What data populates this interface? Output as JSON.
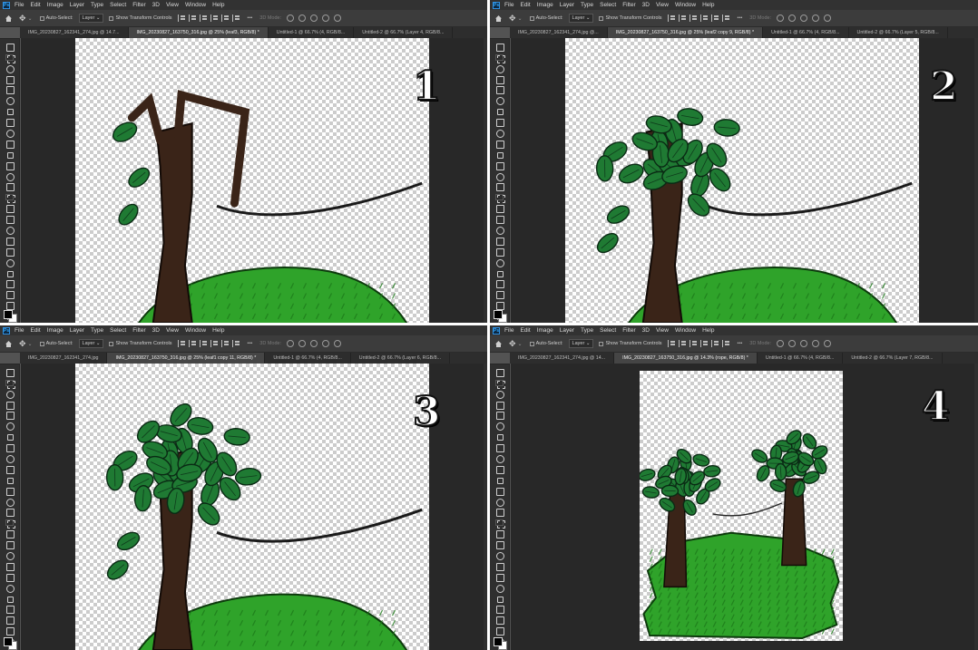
{
  "menu": {
    "ps_logo": "Ps",
    "items": [
      "File",
      "Edit",
      "Image",
      "Layer",
      "Type",
      "Select",
      "Filter",
      "3D",
      "View",
      "Window",
      "Help"
    ]
  },
  "options_bar": {
    "home_icon": "home-icon",
    "move_icon": "move-tool-icon",
    "caret": "⌄",
    "auto_select": "Auto-Select:",
    "layer": "Layer",
    "transform": "Show Transform Controls",
    "more": "•••",
    "mode3d": "3D Mode:"
  },
  "panels": [
    {
      "step": "1",
      "tabs": [
        {
          "label": "IMG_20230827_162341_274.jpg @ 14.7...",
          "active": false
        },
        {
          "label": "IMG_20230827_163750_316.jpg @ 25% (leaf3, RGB/8) *",
          "active": true
        },
        {
          "label": "Untitled-1 @ 66.7% (4, RGB/8...",
          "active": false
        },
        {
          "label": "Untitled-2 @ 66.7% (Layer 4, RGB/8...",
          "active": false
        }
      ]
    },
    {
      "step": "2",
      "tabs": [
        {
          "label": "IMG_20230827_162341_274.jpg @...",
          "active": false
        },
        {
          "label": "IMG_20230827_163750_316.jpg @ 25% (leaf2 copy 9, RGB/8) *",
          "active": true
        },
        {
          "label": "Untitled-1 @ 66.7% (4, RGB/8...",
          "active": false
        },
        {
          "label": "Untitled-2 @ 66.7% (Layer 5, RGB/8...",
          "active": false
        }
      ]
    },
    {
      "step": "3",
      "tabs": [
        {
          "label": "IMG_20230827_162341_274.jpg",
          "active": false
        },
        {
          "label": "IMG_20230827_163750_316.jpg @ 25% (leaf1 copy 11, RGB/8) *",
          "active": true
        },
        {
          "label": "Untitled-1 @ 66.7% (4, RGB/8...",
          "active": false
        },
        {
          "label": "Untitled-2 @ 66.7% (Layer 6, RGB/8...",
          "active": false
        }
      ]
    },
    {
      "step": "4",
      "tabs": [
        {
          "label": "IMG_20230827_162341_274.jpg @ 14...",
          "active": false
        },
        {
          "label": "IMG_20230827_163750_316.jpg @ 14.3% (rope, RGB/8) *",
          "active": true
        },
        {
          "label": "Untitled-1 @ 66.7% (4, RGB/8...",
          "active": false
        },
        {
          "label": "Untitled-2 @ 66.7% (Layer 7, RGB/8...",
          "active": false
        }
      ]
    }
  ],
  "colors": {
    "foreground": "#000000",
    "background": "#ffffff",
    "grass": "#2fa32a",
    "trunk": "#3a2418",
    "leaf": "#1f7a33"
  }
}
